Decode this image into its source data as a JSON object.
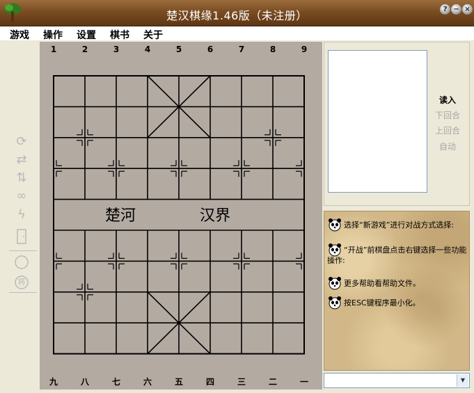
{
  "window": {
    "title": "楚汉棋缘1.46版（未注册）",
    "buttons": {
      "help": "?",
      "minimize": "−",
      "close": "×"
    }
  },
  "menu": [
    "游戏",
    "操作",
    "设置",
    "棋书",
    "关于"
  ],
  "board": {
    "top_labels": [
      "1",
      "2",
      "3",
      "4",
      "5",
      "6",
      "7",
      "8",
      "9"
    ],
    "bottom_labels": [
      "九",
      "八",
      "七",
      "六",
      "五",
      "四",
      "三",
      "二",
      "一"
    ],
    "river_left": "楚河",
    "river_right": "汉界"
  },
  "toolbar_icons": [
    "redo-arrows-icon",
    "swap-arrows-icon",
    "flip-updown-icon",
    "link-icon",
    "lightning-icon",
    "door-icon",
    "circle-icon",
    "general-piece-icon"
  ],
  "toolbar_labels": {
    "general_piece": "将"
  },
  "playback": {
    "read": "读入",
    "next": "下回合",
    "prev": "上回合",
    "auto": "自动"
  },
  "help": {
    "tips": [
      "选择“新游戏”进行对战方式选择:",
      "“开战”前棋盘点击右键选择一些功能操作:",
      "更多帮助看帮助文件。",
      "按ESC键程序最小化。"
    ]
  },
  "status": {
    "combo_value": ""
  }
}
